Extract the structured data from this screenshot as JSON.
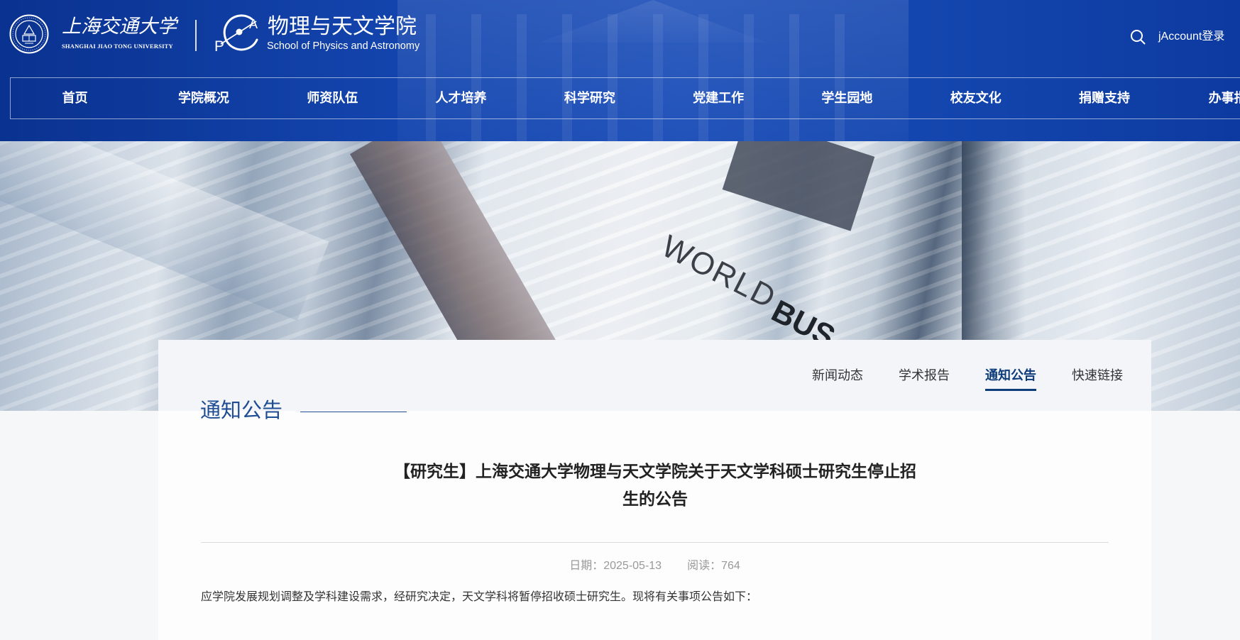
{
  "header": {
    "university": {
      "name_cn": "上海交通大学",
      "name_en": "SHANGHAI JIAO TONG UNIVERSITY",
      "logo_icon": "sjtu-seal-logo"
    },
    "school": {
      "logo_letters": [
        "P",
        "A"
      ],
      "name_cn": "物理与天文学院",
      "name_en": "School of Physics and Astronomy"
    },
    "search_icon": "search-icon",
    "login_label": "jAccount登录"
  },
  "nav": {
    "items": [
      "首页",
      "学院概况",
      "师资队伍",
      "人才培养",
      "科学研究",
      "党建工作",
      "学生园地",
      "校友文化",
      "捐赠支持",
      "办事指"
    ]
  },
  "banner": {
    "photo_text": [
      "WORLD",
      "BUS"
    ]
  },
  "section": {
    "tabs": [
      {
        "label": "新闻动态",
        "active": false
      },
      {
        "label": "学术报告",
        "active": false
      },
      {
        "label": "通知公告",
        "active": true
      },
      {
        "label": "快速链接",
        "active": false
      }
    ],
    "title": "通知公告"
  },
  "article": {
    "title": "【研究生】上海交通大学物理与天文学院关于天文学科硕士研究生停止招生的公告",
    "date_label": "日期：",
    "date": "2025-05-13",
    "views_label": "阅读：",
    "views": "764",
    "paragraphs": [
      "应学院发展规划调整及学科建设需求，经研究决定，天文学科将暂停招收硕士研究生。现将有关事项公告如下："
    ]
  },
  "colors": {
    "header_blue": "#1446b0",
    "accent": "#1f4d93",
    "active_tab": "#0d3c7a",
    "text_main": "#222222",
    "text_muted": "#999999"
  }
}
